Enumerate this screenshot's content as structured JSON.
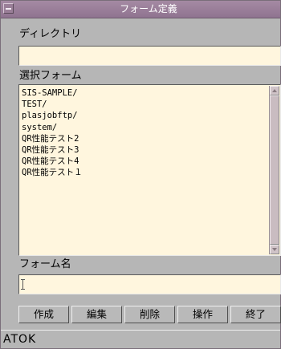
{
  "window": {
    "title": "フォーム定義"
  },
  "directory": {
    "label": "ディレクトリ",
    "value": ""
  },
  "form_list": {
    "label": "選択フォーム",
    "items": [
      "SIS-SAMPLE/",
      "TEST/",
      "plasjobftp/",
      "system/",
      "QR性能テスト2",
      "QR性能テスト3",
      "QR性能テスト4",
      "QR性能テスト１"
    ]
  },
  "form_name": {
    "label": "フォーム名",
    "value": ""
  },
  "buttons": {
    "create": "作成",
    "edit": "編集",
    "delete": "削除",
    "operate": "操作",
    "exit": "終了"
  },
  "status": {
    "text": "ATOK"
  },
  "colors": {
    "titlebar": "#9a7f98",
    "field_bg": "#fff6de",
    "window_bg": "#b6b6b6"
  }
}
